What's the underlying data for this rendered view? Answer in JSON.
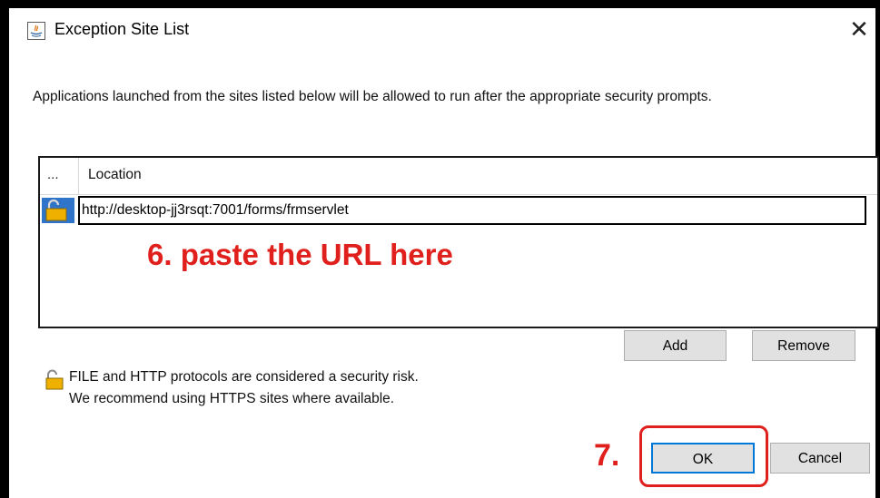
{
  "dialog": {
    "title": "Exception Site List",
    "description": "Applications launched from the sites listed below will be allowed to run after the appropriate security prompts."
  },
  "table": {
    "header_dots": "...",
    "header_location": "Location",
    "rows": [
      {
        "location": "http://desktop-jj3rsqt:7001/forms/frmservlet"
      }
    ]
  },
  "annotations": {
    "step6": "6. paste the URL here",
    "step7": "7."
  },
  "buttons": {
    "add": "Add",
    "remove": "Remove",
    "ok": "OK",
    "cancel": "Cancel"
  },
  "warning": {
    "line1": "FILE and HTTP protocols are considered a security risk.",
    "line2": "We recommend using HTTPS sites where available."
  },
  "colors": {
    "annotation": "#e0201c",
    "selection": "#2f74c8",
    "button_bg": "#e1e1e1",
    "ok_border": "#0078d7"
  }
}
